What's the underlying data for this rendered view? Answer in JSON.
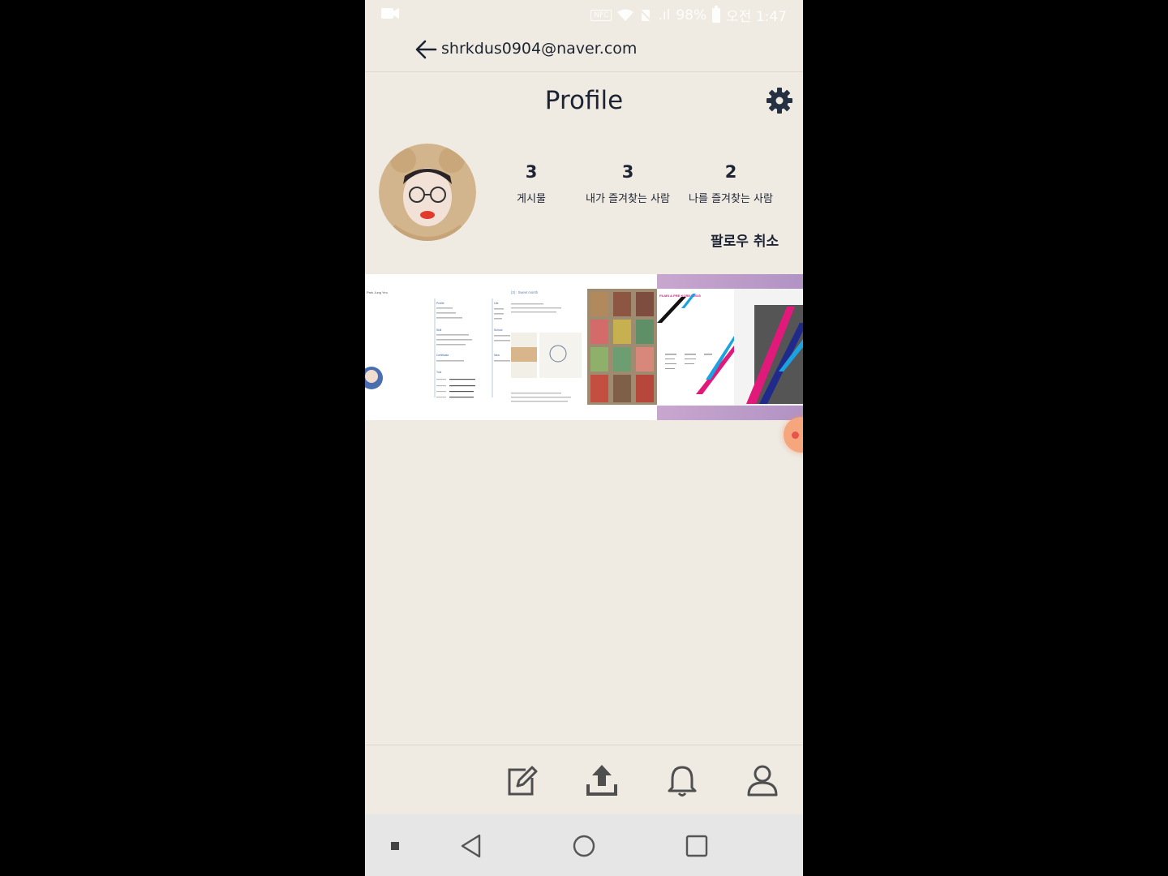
{
  "status_bar": {
    "nfc": "NFC",
    "signal": ".ıl",
    "battery_percent": "98%",
    "time": "오전 1:47"
  },
  "header": {
    "account_email": "shrkdus0904@naver.com"
  },
  "profile": {
    "title": "Profile",
    "stats": [
      {
        "count": "3",
        "label": "게시물"
      },
      {
        "count": "3",
        "label": "내가 즐겨찾는 사람"
      },
      {
        "count": "2",
        "label": "나를 즐겨찾는 사람"
      }
    ],
    "unfollow_label": "팔로우 취소"
  },
  "posts": {
    "resume_heading": "(3) : Sweet month",
    "resume_name": "Park Jung Yeo",
    "resume_sections": [
      "Profile",
      "Skill",
      "Certificate",
      "Tool",
      "Life",
      "School",
      "Idea"
    ],
    "poster_title": "FILMS & PRE KOREA 2015"
  },
  "icons": {
    "back": "arrow-left-icon",
    "settings": "gear-icon",
    "write": "edit-icon",
    "upload": "upload-icon",
    "notifications": "bell-icon",
    "profile": "user-icon"
  },
  "colors": {
    "background": "#efebe3",
    "text": "#1c2433",
    "nav_bar": "#e6e6e6",
    "fab": "#f5a67d"
  }
}
